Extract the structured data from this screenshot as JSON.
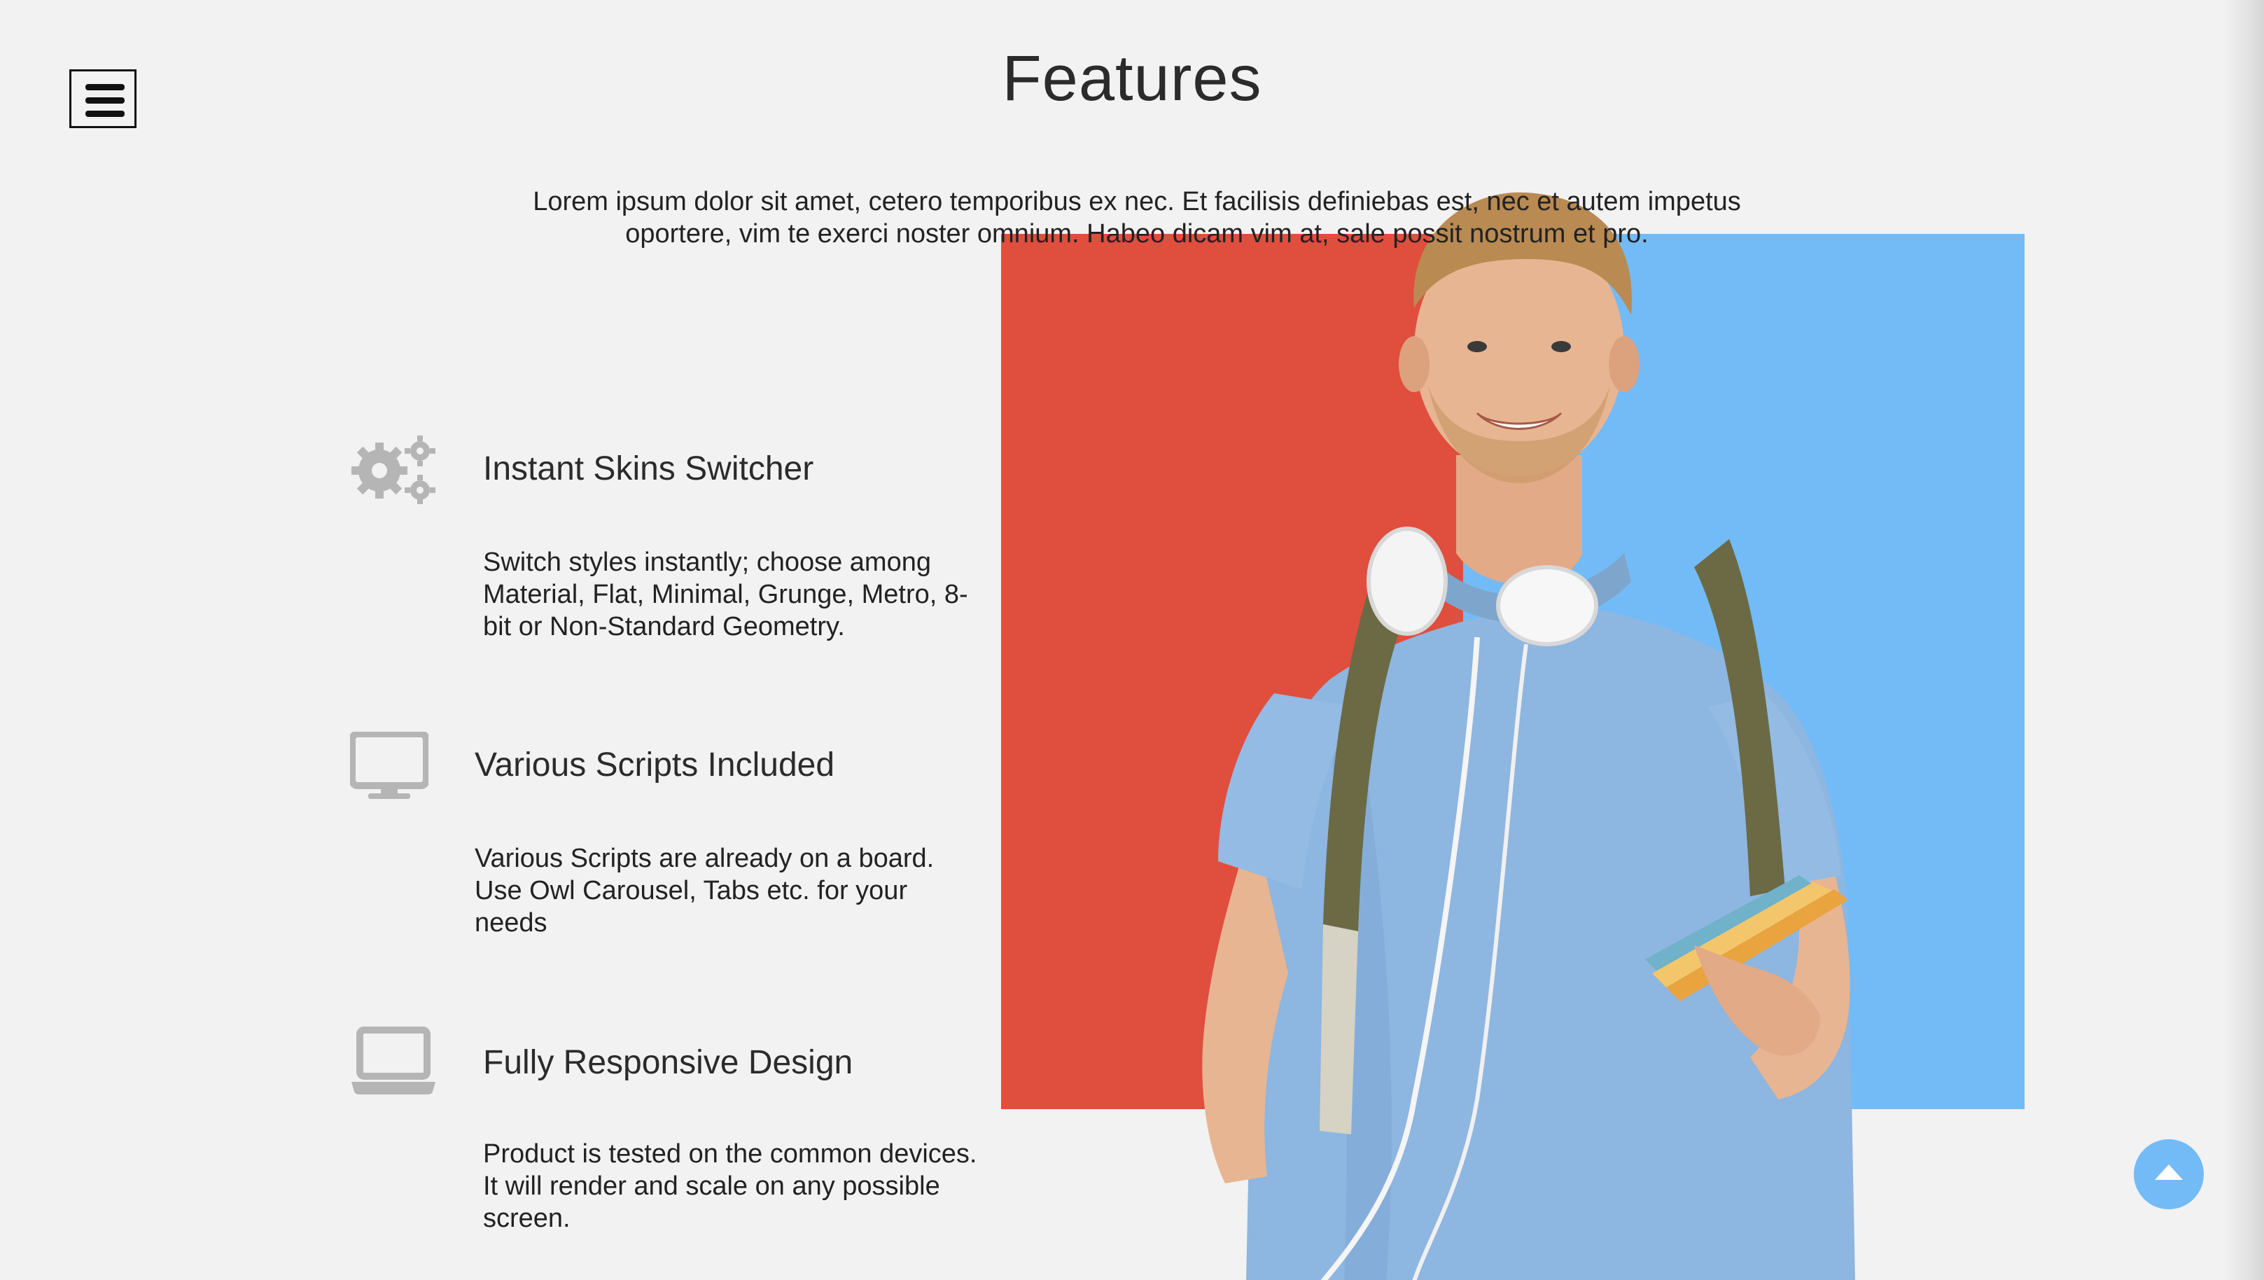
{
  "header": {
    "title": "Features",
    "intro": "Lorem ipsum dolor sit amet, cetero temporibus ex nec. Et facilisis definiebas est, nec et autem impetus oportere, vim te exerci noster omnium. Habeo dicam vim at, sale possit nostrum et pro."
  },
  "menu": {
    "icon": "hamburger-menu-icon"
  },
  "features": [
    {
      "icon": "gears-icon",
      "title": "Instant Skins Switcher",
      "text": "Switch styles instantly; choose among Material, Flat, Minimal, Grunge, Metro, 8-bit or Non-Standard Geometry."
    },
    {
      "icon": "desktop-monitor-icon",
      "title": "Various Scripts Included",
      "text": "Various Scripts are already on a board. Use Owl Carousel, Tabs etc. for your needs"
    },
    {
      "icon": "laptop-icon",
      "title": "Fully Responsive Design",
      "text": "Product is tested on the common devices. It will render and scale on any possible screen."
    }
  ],
  "hero": {
    "colors": {
      "left_block": "#e04e3e",
      "right_block": "#72bbf7"
    }
  },
  "scroll_top": {
    "icon": "arrow-up-icon",
    "color": "#72bbf7"
  }
}
